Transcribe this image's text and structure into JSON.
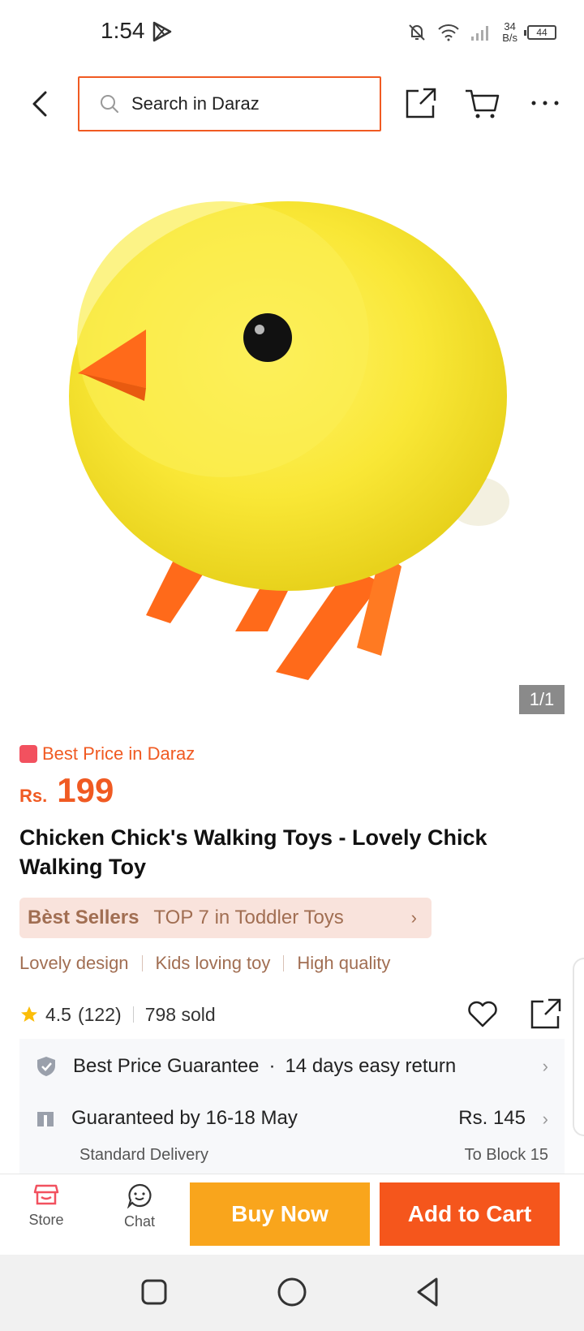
{
  "status_bar": {
    "time": "1:54",
    "net_speed_value": "34",
    "net_speed_unit": "B/s",
    "battery": "44"
  },
  "search": {
    "placeholder": "Search in Daraz"
  },
  "gallery": {
    "counter": "1/1"
  },
  "product": {
    "promo": "Best Price in Daraz",
    "currency": "Rs.",
    "price": "199",
    "title": "Chicken Chick's Walking Toys - Lovely Chick Walking Toy",
    "best_sellers_label": "Bèst Sellers",
    "best_sellers_rank": "TOP 7 in Toddler Toys",
    "tags": [
      "Lovely design",
      "Kids loving toy",
      "High quality"
    ],
    "rating": "4.5",
    "review_count": "(122)",
    "sold": "798 sold"
  },
  "services": {
    "guarantee": "Best Price Guarantee",
    "return_policy": "14 days easy return",
    "delivery_date": "Guaranteed by 16-18 May",
    "delivery_type": "Standard Delivery",
    "delivery_fee": "Rs. 145",
    "destination": "To Block 15"
  },
  "action_bar": {
    "store_label": "Store",
    "chat_label": "Chat",
    "buy_now": "Buy Now",
    "add_to_cart": "Add to Cart"
  },
  "colors": {
    "brand_orange": "#f05a22",
    "buy_now": "#f9a51c",
    "add_to_cart": "#f5561c"
  }
}
